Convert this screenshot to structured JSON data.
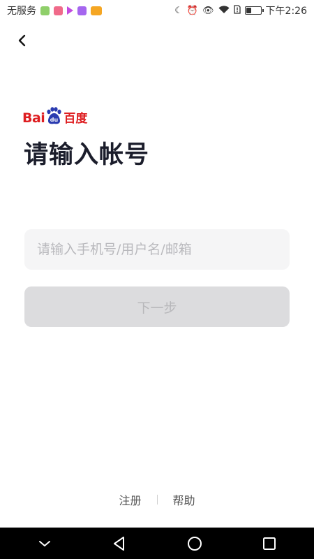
{
  "status_bar": {
    "carrier": "无服务",
    "time": "下午2:26",
    "battery_level": 0.35,
    "app_icon_colors": [
      "#8fcf6a",
      "#f06a8a",
      "#c34be0",
      "#a566ef",
      "#f5a623"
    ]
  },
  "header": {
    "back_icon": "chevron-left-icon"
  },
  "brand": {
    "logo_text_bai": "Bai",
    "logo_text_du": "百度",
    "logo_color": "#de1e21"
  },
  "main": {
    "title": "请输入帐号",
    "account_input": {
      "value": "",
      "placeholder": "请输入手机号/用户名/邮箱"
    },
    "next_button_label": "下一步"
  },
  "footer": {
    "register_label": "注册",
    "help_label": "帮助"
  },
  "nav_bar": {
    "keys": [
      "chevron-down-icon",
      "back-triangle-icon",
      "home-circle-icon",
      "recents-square-icon"
    ]
  }
}
